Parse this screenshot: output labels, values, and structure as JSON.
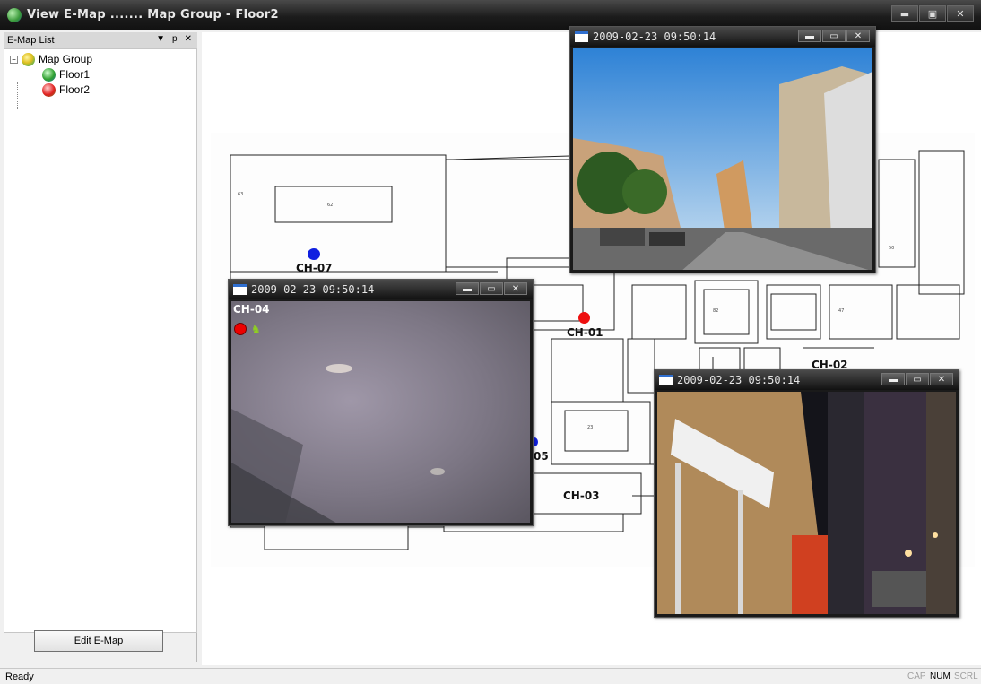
{
  "window": {
    "title": "View E-Map ....... Map Group - Floor2",
    "buttons": [
      "▬",
      "▣",
      "✕"
    ]
  },
  "emap_list": {
    "header": "E-Map List",
    "controls": [
      "▼",
      "ᵽ",
      "✕"
    ],
    "tree": {
      "root": "Map Group",
      "children": [
        "Floor1",
        "Floor2"
      ]
    },
    "edit_button": "Edit E-Map"
  },
  "map": {
    "channels": [
      {
        "label": "CH-07",
        "color": "#1020e0"
      },
      {
        "label": "CH-01",
        "color": "#ee1010"
      },
      {
        "label": "CH-02",
        "color": "#1020e0"
      },
      {
        "label": "CH-03",
        "color": "#1020e0"
      },
      {
        "label": "05",
        "color": "#1020e0"
      }
    ]
  },
  "popups": [
    {
      "timestamp": "2009-02-23  09:50:14",
      "channel": ""
    },
    {
      "timestamp": "2009-02-23  09:50:14",
      "channel": "CH-04"
    },
    {
      "timestamp": "2009-02-23  09:50:14",
      "channel": ""
    }
  ],
  "popup_buttons": [
    "▬",
    "▭",
    "✕"
  ],
  "status": {
    "text": "Ready",
    "indicators": [
      "CAP",
      "NUM",
      "SCRL"
    ],
    "active": "NUM"
  }
}
